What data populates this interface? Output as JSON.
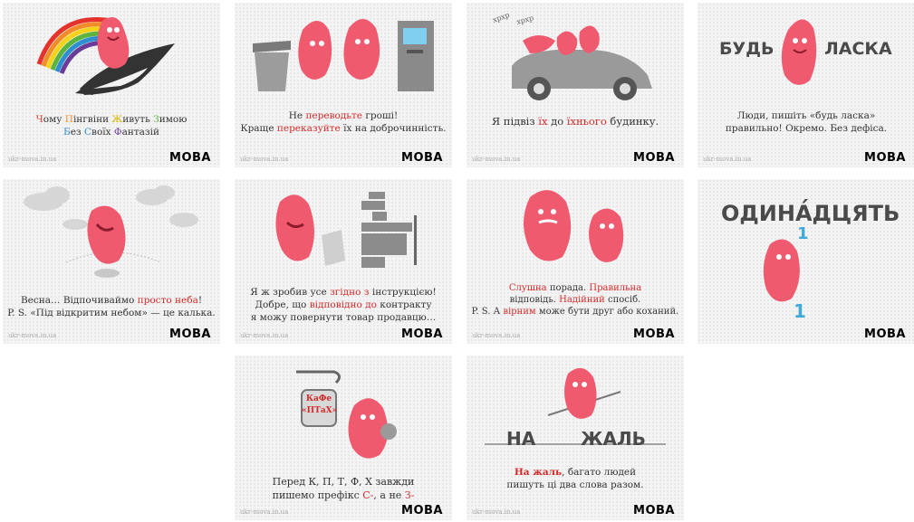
{
  "site": "ukr-mova.in.ua",
  "logo": "МОВА",
  "colors": {
    "accent_red": "#d42a2a",
    "character_pink": "#ef5a6f",
    "logo_blue": "#3fa9d8",
    "logo_green": "#7bbf3f",
    "logo_orange": "#f0a41c",
    "rainbow": [
      "#e5322d",
      "#f28c28",
      "#f5d31b",
      "#5cb33d",
      "#2e8fd0",
      "#6a3c9a"
    ]
  },
  "cards": [
    {
      "caption_words": [
        {
          "first": "Ч",
          "rest": "ому",
          "color": "#e5322d"
        },
        {
          "first": "П",
          "rest": "інгвіни",
          "color": "#f28c28"
        },
        {
          "first": "Ж",
          "rest": "ивуть",
          "color": "#d9b400"
        },
        {
          "first": "З",
          "rest": "имою",
          "color": "#5cb33d"
        },
        {
          "first": "Б",
          "rest": "ез",
          "color": "#2e8fd0"
        },
        {
          "first": "С",
          "rest": "воїх",
          "color": "#2e8fd0"
        },
        {
          "first": "Ф",
          "rest": "антазій",
          "color": "#6a3c9a"
        }
      ],
      "icons": [
        "rainbow-icon",
        "penguin-icon",
        "character-icon"
      ]
    },
    {
      "caption": [
        [
          "Не ",
          "переводьте",
          " гроші!"
        ],
        [
          "Краще ",
          "переказуйте",
          " їх на доброчинність."
        ]
      ],
      "icons": [
        "trash-bin-icon",
        "atm-icon",
        "character-icon"
      ]
    },
    {
      "sound": "хрхр",
      "caption": [
        [
          "Я підвіз ",
          "їх",
          " до ",
          "їхнього",
          " будинку."
        ]
      ],
      "icons": [
        "car-icon",
        "character-icon"
      ]
    },
    {
      "big_left": "БУДЬ",
      "big_right": "ЛАСКА",
      "caption_lines": [
        "Люди, пишіть «будь ласка»",
        "правильно! Окремо. Без дефіса."
      ],
      "icons": [
        "character-icon"
      ]
    },
    {
      "caption": [
        [
          "Весна… Відпочиваймо ",
          "просто неба",
          "!"
        ],
        [
          "P. S. «Під відкритим небом» — це калька.",
          "",
          ""
        ]
      ],
      "icons": [
        "cloud-icon",
        "character-icon"
      ]
    },
    {
      "caption": [
        [
          "Я ж зробив усе ",
          "згідно з",
          " інструкцією!"
        ],
        [
          "Добре, що ",
          "відповідно до",
          " контракту"
        ],
        [
          "я можу повернути товар продавцю…",
          "",
          ""
        ]
      ],
      "icons": [
        "file-cabinet-icon",
        "paper-icon",
        "character-icon"
      ]
    },
    {
      "caption": [
        [
          "",
          "Слушна",
          " порада. ",
          "Правильна"
        ],
        [
          "відповідь. ",
          "Надійний",
          " спосіб.",
          ""
        ],
        [
          "P. S. А ",
          "вірним",
          " може бути друг або коханий.",
          ""
        ]
      ],
      "icons": [
        "character-icon"
      ]
    },
    {
      "word_prefix": "ОДИН",
      "word_stressed": "А́",
      "word_suffix": "ДЦЯТЬ",
      "digit": "1",
      "icons": [
        "character-icon"
      ]
    },
    {
      "sign_line1": "КаФе",
      "sign_line2": "«ПТаХ»",
      "caption": [
        [
          "Перед К, П, Т, Ф, Х завжди",
          "",
          ""
        ],
        [
          "пишемо префікс ",
          "С-",
          ", а не ",
          "З-"
        ]
      ],
      "icons": [
        "hanging-sign-icon",
        "character-icon"
      ]
    },
    {
      "word_left": "НА",
      "word_right": "ЖАЛЬ",
      "caption": [
        [
          "",
          "На жаль",
          ", багато людей"
        ],
        [
          "пишуть ці два слова разом.",
          "",
          ""
        ]
      ],
      "icons": [
        "tightrope-icon",
        "character-icon"
      ]
    }
  ]
}
